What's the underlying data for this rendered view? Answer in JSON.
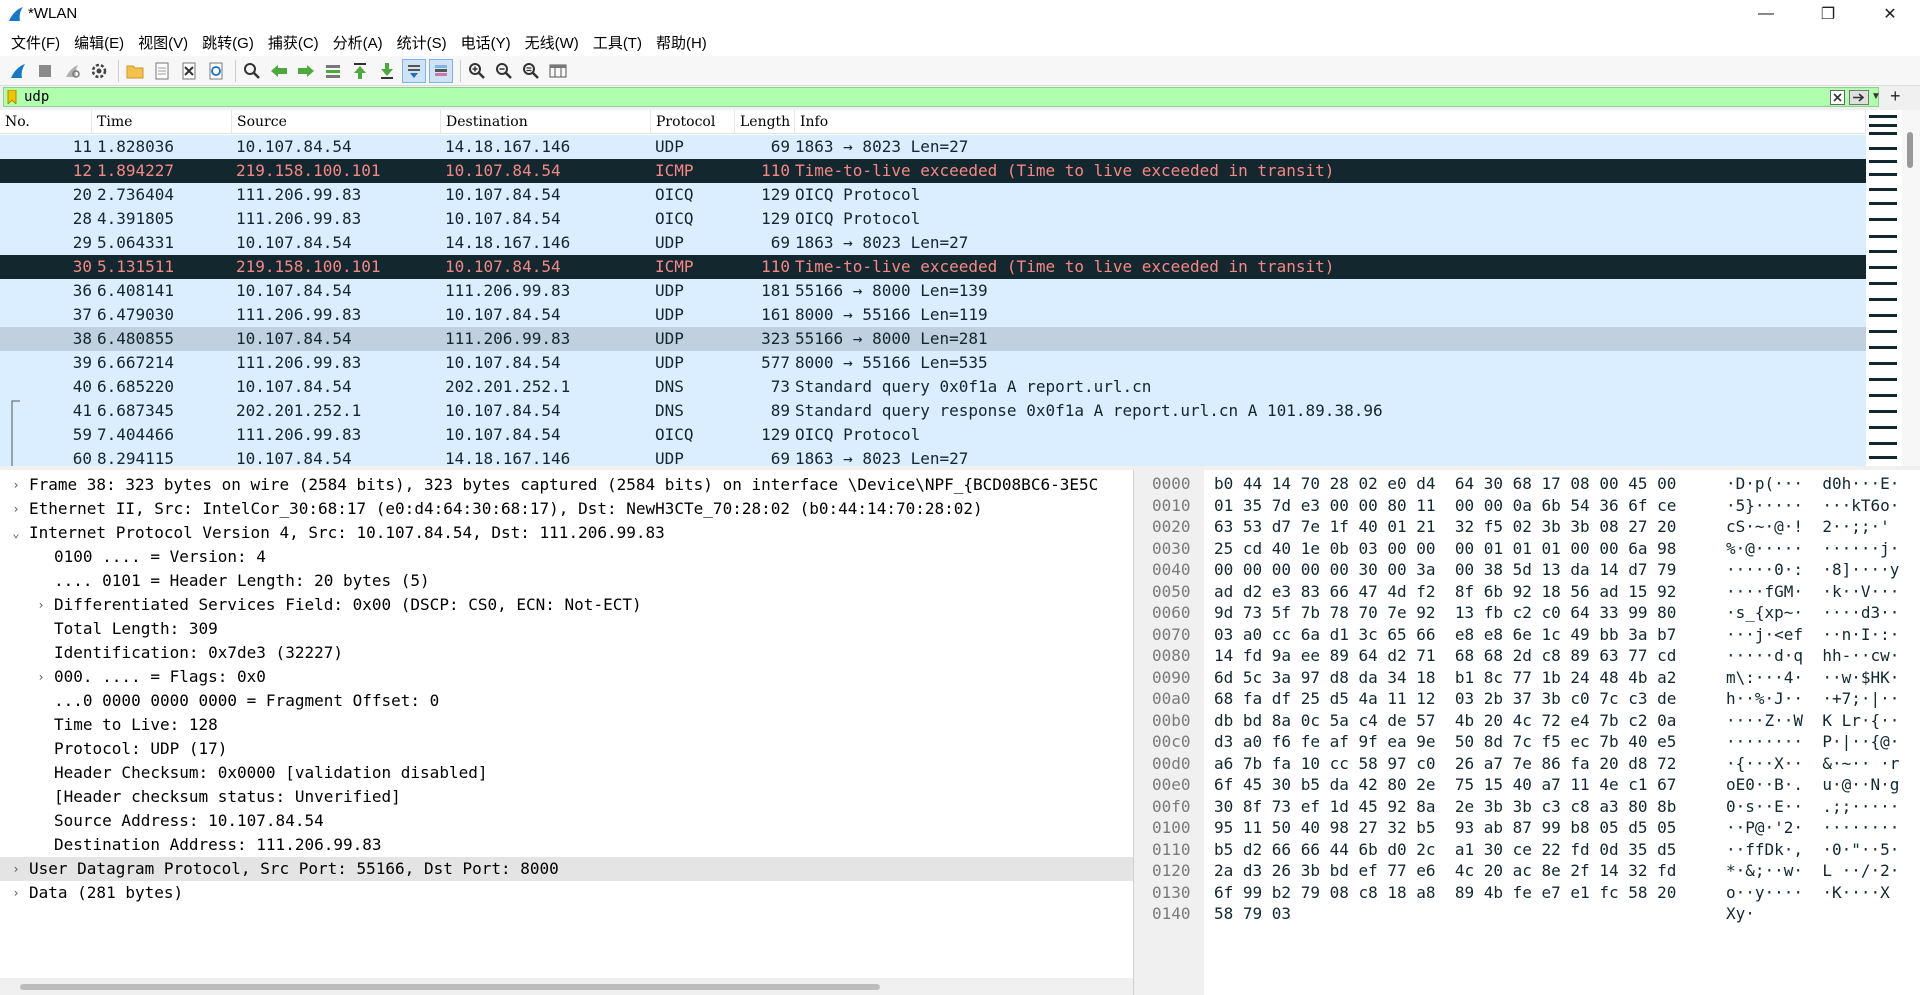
{
  "window": {
    "title": "*WLAN",
    "minimize": "—",
    "restore": "❐",
    "close": "✕"
  },
  "menu": [
    "文件(F)",
    "编辑(E)",
    "视图(V)",
    "跳转(G)",
    "捕获(C)",
    "分析(A)",
    "统计(S)",
    "电话(Y)",
    "无线(W)",
    "工具(T)",
    "帮助(H)"
  ],
  "filter": {
    "value": "udp",
    "add_label": "+"
  },
  "packet_list": {
    "columns": [
      "No.",
      "Time",
      "Source",
      "Destination",
      "Protocol",
      "Length",
      "Info"
    ],
    "rows": [
      {
        "no": "11",
        "time": "1.828036",
        "src": "10.107.84.54",
        "dst": "14.18.167.146",
        "proto": "UDP",
        "len": "69",
        "info": "1863 → 8023 Len=27",
        "style": "udp"
      },
      {
        "no": "12",
        "time": "1.894227",
        "src": "219.158.100.101",
        "dst": "10.107.84.54",
        "proto": "ICMP",
        "len": "110",
        "info": "Time-to-live exceeded (Time to live exceeded in transit)",
        "style": "icmp"
      },
      {
        "no": "20",
        "time": "2.736404",
        "src": "111.206.99.83",
        "dst": "10.107.84.54",
        "proto": "OICQ",
        "len": "129",
        "info": "OICQ Protocol",
        "style": "udp"
      },
      {
        "no": "28",
        "time": "4.391805",
        "src": "111.206.99.83",
        "dst": "10.107.84.54",
        "proto": "OICQ",
        "len": "129",
        "info": "OICQ Protocol",
        "style": "udp"
      },
      {
        "no": "29",
        "time": "5.064331",
        "src": "10.107.84.54",
        "dst": "14.18.167.146",
        "proto": "UDP",
        "len": "69",
        "info": "1863 → 8023 Len=27",
        "style": "udp"
      },
      {
        "no": "30",
        "time": "5.131511",
        "src": "219.158.100.101",
        "dst": "10.107.84.54",
        "proto": "ICMP",
        "len": "110",
        "info": "Time-to-live exceeded (Time to live exceeded in transit)",
        "style": "icmp"
      },
      {
        "no": "36",
        "time": "6.408141",
        "src": "10.107.84.54",
        "dst": "111.206.99.83",
        "proto": "UDP",
        "len": "181",
        "info": "55166 → 8000 Len=139",
        "style": "udp"
      },
      {
        "no": "37",
        "time": "6.479030",
        "src": "111.206.99.83",
        "dst": "10.107.84.54",
        "proto": "UDP",
        "len": "161",
        "info": "8000 → 55166 Len=119",
        "style": "udp"
      },
      {
        "no": "38",
        "time": "6.480855",
        "src": "10.107.84.54",
        "dst": "111.206.99.83",
        "proto": "UDP",
        "len": "323",
        "info": "55166 → 8000 Len=281",
        "style": "sel"
      },
      {
        "no": "39",
        "time": "6.667214",
        "src": "111.206.99.83",
        "dst": "10.107.84.54",
        "proto": "UDP",
        "len": "577",
        "info": "8000 → 55166 Len=535",
        "style": "udp"
      },
      {
        "no": "40",
        "time": "6.685220",
        "src": "10.107.84.54",
        "dst": "202.201.252.1",
        "proto": "DNS",
        "len": "73",
        "info": "Standard query 0x0f1a A report.url.cn",
        "style": "udp"
      },
      {
        "no": "41",
        "time": "6.687345",
        "src": "202.201.252.1",
        "dst": "10.107.84.54",
        "proto": "DNS",
        "len": "89",
        "info": "Standard query response 0x0f1a A report.url.cn A 101.89.38.96",
        "style": "udp"
      },
      {
        "no": "59",
        "time": "7.404466",
        "src": "111.206.99.83",
        "dst": "10.107.84.54",
        "proto": "OICQ",
        "len": "129",
        "info": "OICQ Protocol",
        "style": "udp"
      },
      {
        "no": "60",
        "time": "8.294115",
        "src": "10.107.84.54",
        "dst": "14.18.167.146",
        "proto": "UDP",
        "len": "69",
        "info": "1863 → 8023 Len=27",
        "style": "udp"
      }
    ]
  },
  "details": [
    {
      "text": "Frame 38: 323 bytes on wire (2584 bits), 323 bytes captured (2584 bits) on interface \\Device\\NPF_{BCD08BC6-3E5C",
      "indent": 0,
      "arrow": "›",
      "sel": false
    },
    {
      "text": "Ethernet II, Src: IntelCor_30:68:17 (e0:d4:64:30:68:17), Dst: NewH3CTe_70:28:02 (b0:44:14:70:28:02)",
      "indent": 0,
      "arrow": "›",
      "sel": false
    },
    {
      "text": "Internet Protocol Version 4, Src: 10.107.84.54, Dst: 111.206.99.83",
      "indent": 0,
      "arrow": "⌄",
      "sel": false
    },
    {
      "text": "0100 .... = Version: 4",
      "indent": 1,
      "arrow": "",
      "sel": false
    },
    {
      "text": ".... 0101 = Header Length: 20 bytes (5)",
      "indent": 1,
      "arrow": "",
      "sel": false
    },
    {
      "text": "Differentiated Services Field: 0x00 (DSCP: CS0, ECN: Not-ECT)",
      "indent": 1,
      "arrow": "›",
      "sel": false
    },
    {
      "text": "Total Length: 309",
      "indent": 1,
      "arrow": "",
      "sel": false
    },
    {
      "text": "Identification: 0x7de3 (32227)",
      "indent": 1,
      "arrow": "",
      "sel": false
    },
    {
      "text": "000. .... = Flags: 0x0",
      "indent": 1,
      "arrow": "›",
      "sel": false
    },
    {
      "text": "...0 0000 0000 0000 = Fragment Offset: 0",
      "indent": 1,
      "arrow": "",
      "sel": false
    },
    {
      "text": "Time to Live: 128",
      "indent": 1,
      "arrow": "",
      "sel": false
    },
    {
      "text": "Protocol: UDP (17)",
      "indent": 1,
      "arrow": "",
      "sel": false
    },
    {
      "text": "Header Checksum: 0x0000 [validation disabled]",
      "indent": 1,
      "arrow": "",
      "sel": false
    },
    {
      "text": "[Header checksum status: Unverified]",
      "indent": 1,
      "arrow": "",
      "sel": false
    },
    {
      "text": "Source Address: 10.107.84.54",
      "indent": 1,
      "arrow": "",
      "sel": false
    },
    {
      "text": "Destination Address: 111.206.99.83",
      "indent": 1,
      "arrow": "",
      "sel": false
    },
    {
      "text": "User Datagram Protocol, Src Port: 55166, Dst Port: 8000",
      "indent": 0,
      "arrow": "›",
      "sel": true
    },
    {
      "text": "Data (281 bytes)",
      "indent": 0,
      "arrow": "›",
      "sel": false
    }
  ],
  "bytes": [
    {
      "off": "0000",
      "hex": "b0 44 14 70 28 02 e0 d4  64 30 68 17 08 00 45 00",
      "ascii": "·D·p(···  d0h···E·"
    },
    {
      "off": "0010",
      "hex": "01 35 7d e3 00 00 80 11  00 00 0a 6b 54 36 6f ce",
      "ascii": "·5}·····  ···kT6o·"
    },
    {
      "off": "0020",
      "hex": "63 53 d7 7e 1f 40 01 21  32 f5 02 3b 3b 08 27 20",
      "ascii": "cS·~·@·!  2··;;·' "
    },
    {
      "off": "0030",
      "hex": "25 cd 40 1e 0b 03 00 00  00 01 01 01 00 00 6a 98",
      "ascii": "%·@·····  ······j·"
    },
    {
      "off": "0040",
      "hex": "00 00 00 00 00 30 00 3a  00 38 5d 13 da 14 d7 79",
      "ascii": "·····0·:  ·8]····y"
    },
    {
      "off": "0050",
      "hex": "ad d2 e3 83 66 47 4d f2  8f 6b 92 18 56 ad 15 92",
      "ascii": "····fGM·  ·k··V···"
    },
    {
      "off": "0060",
      "hex": "9d 73 5f 7b 78 70 7e 92  13 fb c2 c0 64 33 99 80",
      "ascii": "·s_{xp~·  ····d3··"
    },
    {
      "off": "0070",
      "hex": "03 a0 cc 6a d1 3c 65 66  e8 e8 6e 1c 49 bb 3a b7",
      "ascii": "···j·<ef  ··n·I·:·"
    },
    {
      "off": "0080",
      "hex": "14 fd 9a ee 89 64 d2 71  68 68 2d c8 89 63 77 cd",
      "ascii": "·····d·q  hh-··cw·"
    },
    {
      "off": "0090",
      "hex": "6d 5c 3a 97 d8 da 34 18  b1 8c 77 1b 24 48 4b a2",
      "ascii": "m\\:···4·  ··w·$HK·"
    },
    {
      "off": "00a0",
      "hex": "68 fa df 25 d5 4a 11 12  03 2b 37 3b c0 7c c3 de",
      "ascii": "h··%·J··  ·+7;·|··"
    },
    {
      "off": "00b0",
      "hex": "db bd 8a 0c 5a c4 de 57  4b 20 4c 72 e4 7b c2 0a",
      "ascii": "····Z··W  K Lr·{··"
    },
    {
      "off": "00c0",
      "hex": "d3 a0 f6 fe af 9f ea 9e  50 8d 7c f5 ec 7b 40 e5",
      "ascii": "········  P·|··{@·"
    },
    {
      "off": "00d0",
      "hex": "a6 7b fa 10 cc 58 97 c0  26 a7 7e 86 fa 20 d8 72",
      "ascii": "·{···X··  &·~·· ·r"
    },
    {
      "off": "00e0",
      "hex": "6f 45 30 b5 da 42 80 2e  75 15 40 a7 11 4e c1 67",
      "ascii": "oE0··B·.  u·@··N·g"
    },
    {
      "off": "00f0",
      "hex": "30 8f 73 ef 1d 45 92 8a  2e 3b 3b c3 c8 a3 80 8b",
      "ascii": "0·s··E··  .;;·····"
    },
    {
      "off": "0100",
      "hex": "95 11 50 40 98 27 32 b5  93 ab 87 99 b8 05 d5 05",
      "ascii": "··P@·'2·  ········"
    },
    {
      "off": "0110",
      "hex": "b5 d2 66 66 44 6b d0 2c  a1 30 ce 22 fd 0d 35 d5",
      "ascii": "··ffDk·,  ·0·\"··5·"
    },
    {
      "off": "0120",
      "hex": "2a d3 26 3b bd ef 77 e6  4c 20 ac 8e 2f 14 32 fd",
      "ascii": "*·&;··w·  L ··/·2·"
    },
    {
      "off": "0130",
      "hex": "6f 99 b2 79 08 c8 18 a8  89 4b fe e7 e1 fc 58 20",
      "ascii": "o··y····  ·K····X "
    },
    {
      "off": "0140",
      "hex": "58 79 03",
      "ascii": "Xy·"
    }
  ],
  "colors": {
    "udp_row": "#daeeff",
    "icmp_row": "#12272e",
    "icmp_text": "#f78787",
    "filter_ok": "#afffaf"
  }
}
